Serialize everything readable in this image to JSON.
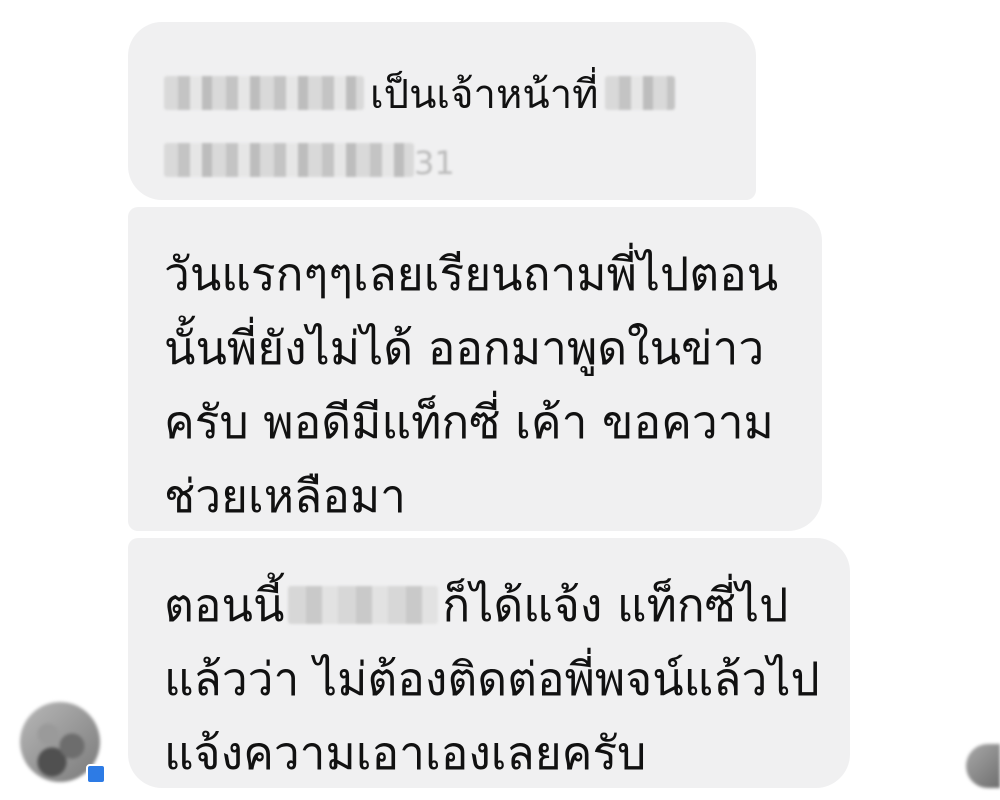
{
  "messages": [
    {
      "lines": [
        {
          "after_redaction": "เป็นเจ้าหน้าที่"
        }
      ],
      "redacted_line2_suffix": "31"
    },
    {
      "lines": [
        "วันแรกๆๆเลยเรียนถามพี่ไปตอน",
        "นั้นพี่ยังไม่ได้  ออกมาพูดในข่าว",
        "ครับ พอดีมีแท็กซี่ เค้า ขอความ",
        "ช่วยเหลือมา"
      ]
    },
    {
      "line1_before": "ตอนนี้",
      "line1_after": "ก็ได้แจ้ง แท็กซี่ไป",
      "lines": [
        "แล้วว่า ไม่ต้องติดต่อพี่พจน์แล้วไป",
        "แจ้งความเอาเองเลยครับ"
      ]
    }
  ],
  "colors": {
    "bubble": "#f0f0f1",
    "text": "#111111",
    "badge": "#2d7be5"
  },
  "icons": {
    "sender_avatar": "avatar",
    "sender_badge": "messenger-badge-icon",
    "read_receipt": "seen-avatar"
  }
}
